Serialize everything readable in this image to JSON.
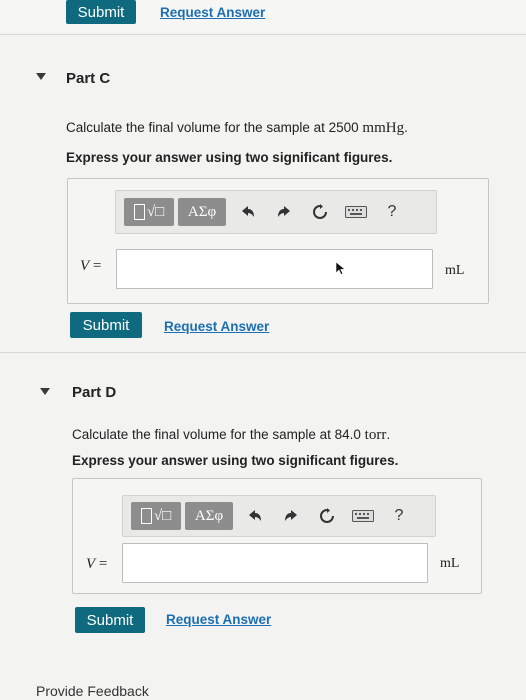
{
  "top": {
    "submit_label": "Submit",
    "request_label": "Request Answer"
  },
  "part_c": {
    "title": "Part C",
    "question_prefix": "Calculate the final volume for the sample at 2500 ",
    "question_unit": "mmHg",
    "question_suffix": ".",
    "instruction": "Express your answer using two significant figures.",
    "toolbar": {
      "template_label": "√□",
      "greek_label": "ΑΣφ",
      "help_label": "?"
    },
    "variable": "V",
    "equals": " =",
    "input_value": "",
    "unit": "mL",
    "submit_label": "Submit",
    "request_label": "Request Answer"
  },
  "part_d": {
    "title": "Part D",
    "question_prefix": "Calculate the final volume for the sample at 84.0 ",
    "question_unit": "torr",
    "question_suffix": ".",
    "instruction": "Express your answer using two significant figures.",
    "toolbar": {
      "template_label": "√□",
      "greek_label": "ΑΣφ",
      "help_label": "?"
    },
    "variable": "V",
    "equals": " =",
    "input_value": "",
    "unit": "mL",
    "submit_label": "Submit",
    "request_label": "Request Answer"
  },
  "footer": {
    "feedback_label": "Provide Feedback"
  }
}
